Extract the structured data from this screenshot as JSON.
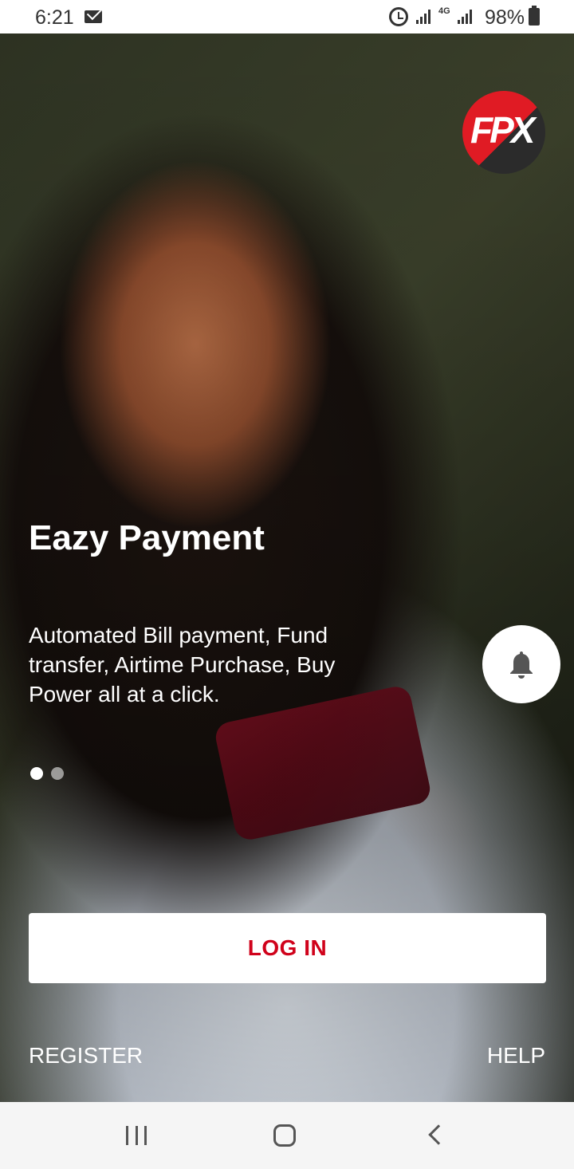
{
  "status_bar": {
    "time": "6:21",
    "network_type": "4G",
    "battery_percent": "98%",
    "icons": [
      "mail-icon",
      "alarm-icon",
      "signal-icon",
      "battery-icon"
    ]
  },
  "brand": {
    "logo_text": "FPX",
    "logo_colors": [
      "#e01b24",
      "#2b2b2b"
    ]
  },
  "onboarding": {
    "title": "Eazy Payment",
    "description": "Automated Bill payment, Fund transfer, Airtime Purchase, Buy Power all at a click.",
    "page_count": 2,
    "active_page": 1
  },
  "actions": {
    "login_label": "LOG IN",
    "register_label": "REGISTER",
    "help_label": "HELP",
    "notification_icon": "bell-icon"
  },
  "colors": {
    "accent": "#d0021b",
    "text_on_image": "#ffffff"
  },
  "nav_bar": {
    "buttons": [
      "recents-icon",
      "home-icon",
      "back-icon"
    ]
  }
}
